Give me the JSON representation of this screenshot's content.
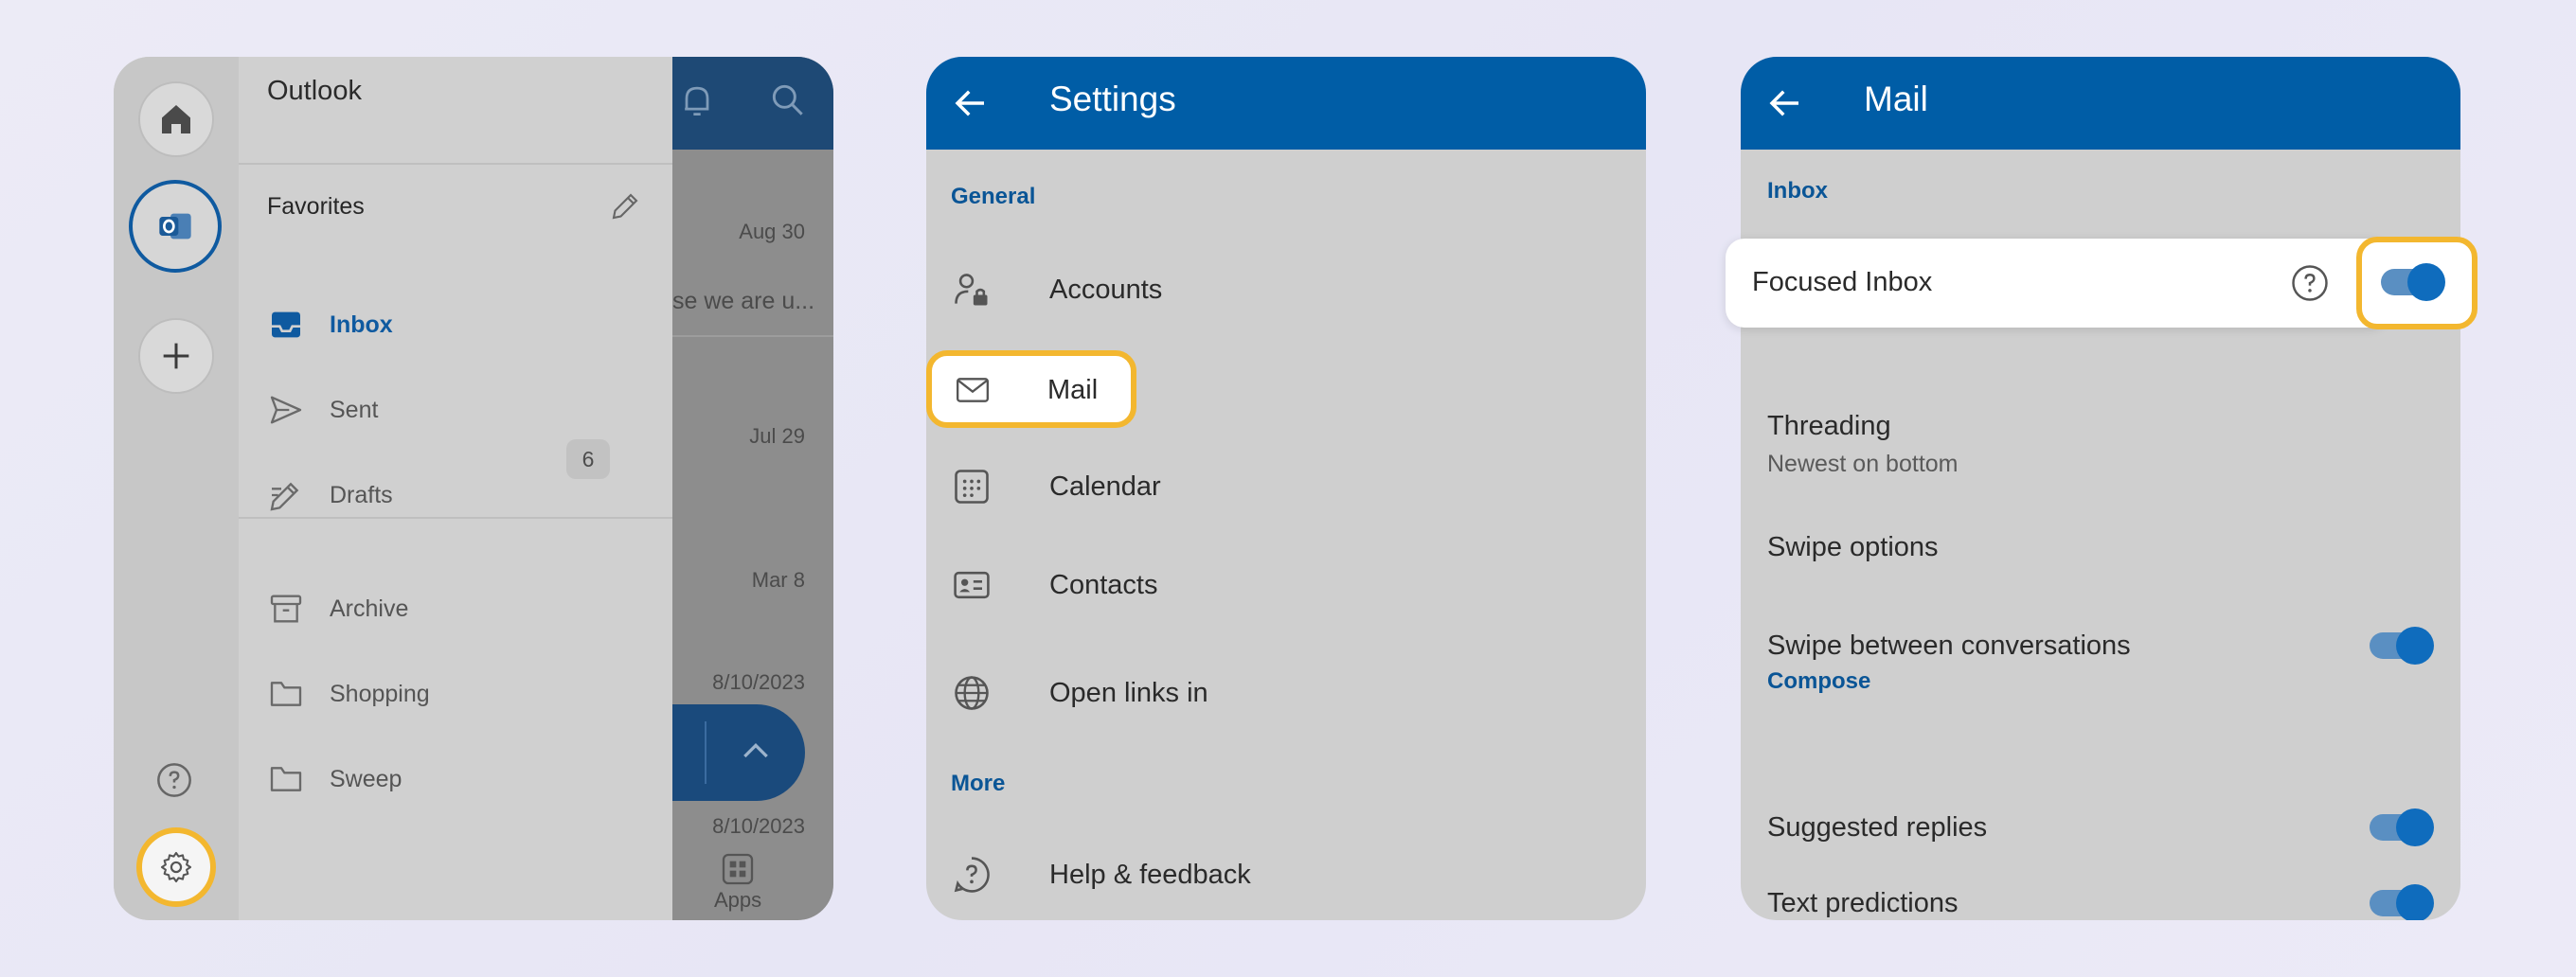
{
  "panel1": {
    "drawer": {
      "app_title": "Outlook",
      "favorites_title": "Favorites",
      "folders": [
        {
          "label": "Inbox",
          "icon": "inbox-icon",
          "active": true
        },
        {
          "label": "Sent",
          "icon": "send-icon"
        },
        {
          "label": "Drafts",
          "icon": "drafts-icon",
          "count": "6"
        },
        {
          "label": "Archive",
          "icon": "archive-icon"
        },
        {
          "label": "Shopping",
          "icon": "folder-icon"
        },
        {
          "label": "Sweep",
          "icon": "folder-icon"
        }
      ]
    },
    "mail_list": {
      "dates": [
        "Aug 30",
        "Jul 29",
        "Mar 8",
        "8/10/2023",
        "8/10/2023"
      ],
      "snippet": "se we are u...",
      "apps_label": "Apps"
    },
    "highlight_color": "#f3b72f"
  },
  "panel2": {
    "title": "Settings",
    "sections": {
      "general": "General",
      "more": "More"
    },
    "items": [
      {
        "label": "Accounts",
        "icon": "account-lock-icon"
      },
      {
        "label": "Mail",
        "icon": "mail-icon",
        "highlighted": true
      },
      {
        "label": "Calendar",
        "icon": "calendar-icon"
      },
      {
        "label": "Contacts",
        "icon": "contact-card-icon"
      },
      {
        "label": "Open links in",
        "icon": "globe-icon"
      },
      {
        "label": "Help & feedback",
        "icon": "help-icon"
      }
    ],
    "header_color": "#005da6"
  },
  "panel3": {
    "title": "Mail",
    "sections": {
      "inbox": "Inbox",
      "compose": "Compose"
    },
    "focused_inbox": {
      "label": "Focused Inbox",
      "enabled": true
    },
    "threading": {
      "label": "Threading",
      "value": "Newest on bottom"
    },
    "swipe_options": {
      "label": "Swipe options"
    },
    "swipe_between": {
      "label": "Swipe between conversations",
      "enabled": true
    },
    "suggested_replies": {
      "label": "Suggested replies",
      "enabled": true
    },
    "text_predictions": {
      "label": "Text predictions",
      "enabled": true
    }
  }
}
